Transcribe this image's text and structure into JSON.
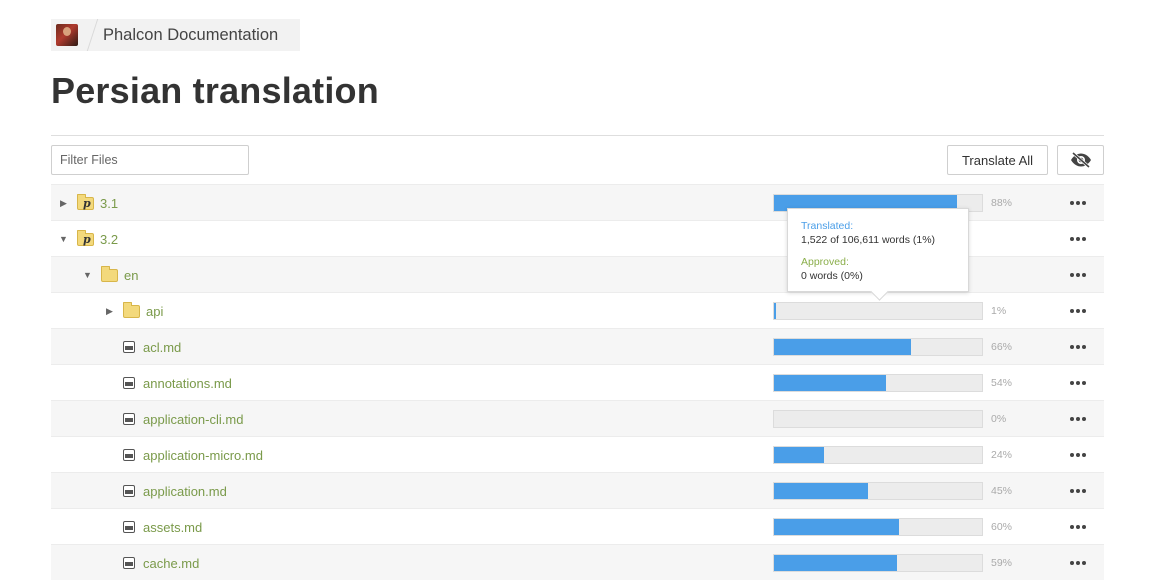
{
  "breadcrumb": {
    "project": "Phalcon Documentation"
  },
  "page_title": "Persian translation",
  "filter": {
    "placeholder": "Filter Files",
    "value": ""
  },
  "toolbar": {
    "translate_all_label": "Translate All",
    "hide_icon": "eye-slash-icon"
  },
  "accent_color": "#4a9ee8",
  "tooltip": {
    "translated_label": "Translated:",
    "translated_value": "1,522 of 106,611 words (1%)",
    "approved_label": "Approved:",
    "approved_value": "0 words (0%)"
  },
  "rows": [
    {
      "name": "3.1",
      "type": "branch",
      "caret": "▶",
      "level": 0,
      "progress": 88,
      "pct_label": "88%"
    },
    {
      "name": "3.2",
      "type": "branch",
      "caret": "▼",
      "level": 0,
      "progress": null,
      "pct_label": ""
    },
    {
      "name": "en",
      "type": "folder",
      "caret": "▼",
      "level": 1,
      "progress": null,
      "pct_label": ""
    },
    {
      "name": "api",
      "type": "folder",
      "caret": "▶",
      "level": 2,
      "progress": 1,
      "pct_label": "1%"
    },
    {
      "name": "acl.md",
      "type": "file",
      "caret": "",
      "level": 2,
      "progress": 66,
      "pct_label": "66%"
    },
    {
      "name": "annotations.md",
      "type": "file",
      "caret": "",
      "level": 2,
      "progress": 54,
      "pct_label": "54%"
    },
    {
      "name": "application-cli.md",
      "type": "file",
      "caret": "",
      "level": 2,
      "progress": 0,
      "pct_label": "0%"
    },
    {
      "name": "application-micro.md",
      "type": "file",
      "caret": "",
      "level": 2,
      "progress": 24,
      "pct_label": "24%"
    },
    {
      "name": "application.md",
      "type": "file",
      "caret": "",
      "level": 2,
      "progress": 45,
      "pct_label": "45%"
    },
    {
      "name": "assets.md",
      "type": "file",
      "caret": "",
      "level": 2,
      "progress": 60,
      "pct_label": "60%"
    },
    {
      "name": "cache.md",
      "type": "file",
      "caret": "",
      "level": 2,
      "progress": 59,
      "pct_label": "59%"
    }
  ]
}
